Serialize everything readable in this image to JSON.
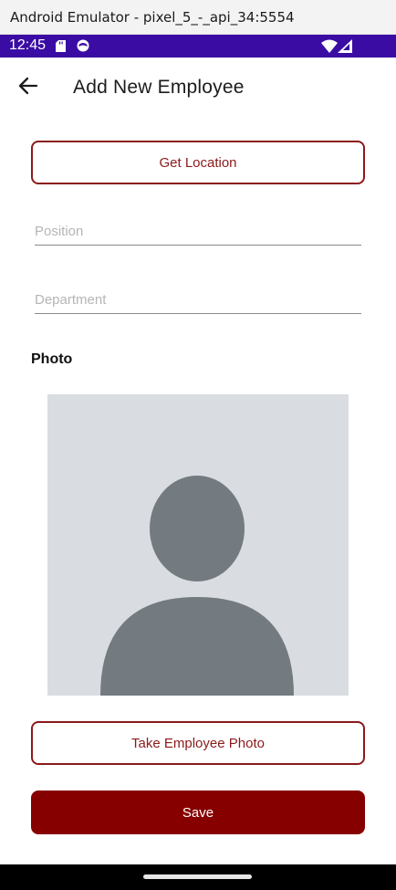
{
  "window": {
    "title": "Android Emulator - pixel_5_-_api_34:5554"
  },
  "status_bar": {
    "time": "12:45",
    "icons": [
      "sd-card-icon",
      "face-icon",
      "wifi-icon",
      "signal-icon"
    ],
    "background": "#3a0ca3"
  },
  "app_bar": {
    "title": "Add New Employee",
    "back_icon": "arrow-left-icon"
  },
  "form": {
    "get_location_label": "Get Location",
    "position": {
      "value": "",
      "placeholder": "Position"
    },
    "department": {
      "value": "",
      "placeholder": "Department"
    },
    "photo_label": "Photo",
    "photo_placeholder_icon": "person-silhouette-icon",
    "take_photo_label": "Take Employee Photo",
    "save_label": "Save"
  },
  "colors": {
    "accent": "#870000",
    "outline": "#8b1a1a",
    "photo_bg": "#d9dde2",
    "silhouette": "#737a80"
  }
}
